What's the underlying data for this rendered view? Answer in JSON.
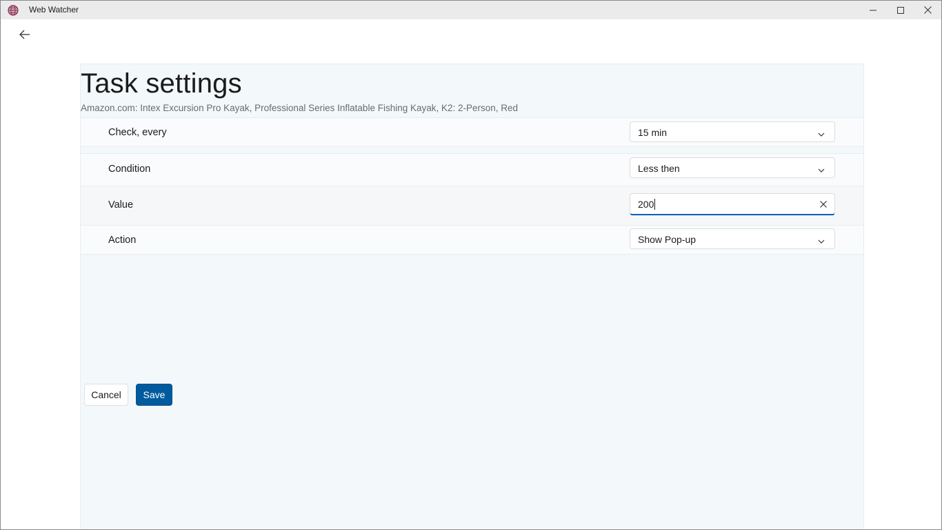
{
  "window": {
    "title": "Web Watcher",
    "accent_color": "#005a9e"
  },
  "header": {
    "back_icon": "arrow-left-icon"
  },
  "page": {
    "title": "Task settings",
    "subtitle": "Amazon.com: Intex Excursion Pro Kayak, Professional Series Inflatable Fishing Kayak, K2: 2-Person, Red"
  },
  "settings": [
    {
      "label": "Check, every",
      "control": "dropdown",
      "value": "15 min"
    },
    {
      "label": "Condition",
      "control": "dropdown",
      "value": "Less then"
    },
    {
      "label": "Value",
      "control": "textbox",
      "value": "200"
    },
    {
      "label": "Action",
      "control": "dropdown",
      "value": "Show Pop-up"
    }
  ],
  "buttons": {
    "cancel_label": "Cancel",
    "save_label": "Save"
  }
}
